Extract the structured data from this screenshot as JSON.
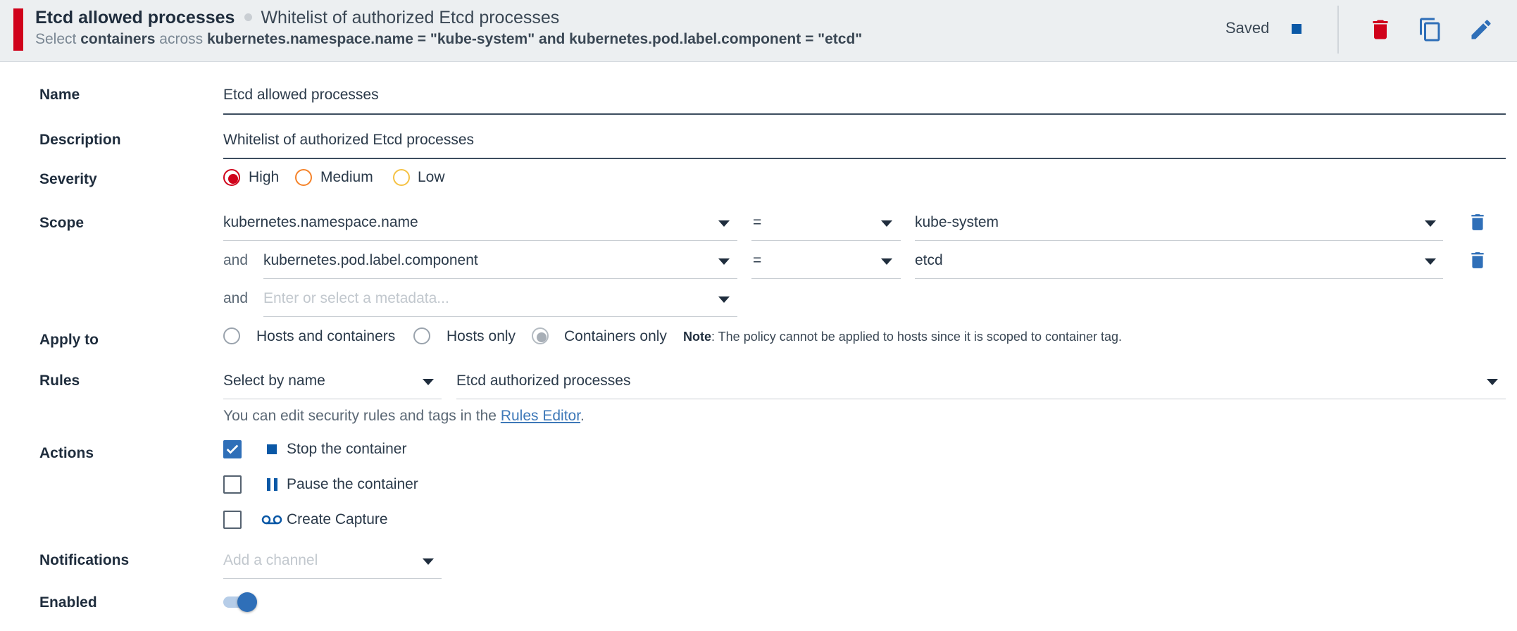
{
  "header": {
    "policy_name": "Etcd allowed processes",
    "policy_description": "Whitelist of authorized Etcd processes",
    "scope_select": "Select",
    "scope_entity": "containers",
    "scope_across": "across",
    "scope_expression": "kubernetes.namespace.name = \"kube-system\" and kubernetes.pod.label.component = \"etcd\"",
    "status": "Saved",
    "severity_color": "#d0021b"
  },
  "form": {
    "name": {
      "label": "Name",
      "value": "Etcd allowed processes"
    },
    "description": {
      "label": "Description",
      "value": "Whitelist of authorized Etcd processes"
    },
    "severity": {
      "label": "Severity",
      "options": [
        {
          "label": "High",
          "color": "#d0021b",
          "selected": true
        },
        {
          "label": "Medium",
          "color": "#f5832a",
          "selected": false
        },
        {
          "label": "Low",
          "color": "#f5c244",
          "selected": false
        }
      ]
    },
    "scope": {
      "label": "Scope",
      "conjunction": "and",
      "rows": [
        {
          "key": "kubernetes.namespace.name",
          "operator": "=",
          "value": "kube-system"
        },
        {
          "key": "kubernetes.pod.label.component",
          "operator": "=",
          "value": "etcd"
        }
      ],
      "new_placeholder": "Enter or select a metadata..."
    },
    "apply_to": {
      "label": "Apply to",
      "options": [
        {
          "label": "Hosts and containers",
          "selected": false
        },
        {
          "label": "Hosts only",
          "selected": false
        },
        {
          "label": "Containers only",
          "selected": true
        }
      ],
      "note_label": "Note",
      "note_text": ": The policy cannot be applied to hosts since it is scoped to container tag."
    },
    "rules": {
      "label": "Rules",
      "mode": "Select by name",
      "value": "Etcd authorized processes",
      "help_prefix": "You can edit security rules and tags in the ",
      "help_link": "Rules Editor",
      "help_suffix": "."
    },
    "actions": {
      "label": "Actions",
      "items": [
        {
          "label": "Stop the container",
          "checked": true,
          "icon": "stop-icon"
        },
        {
          "label": "Pause the container",
          "checked": false,
          "icon": "pause-icon"
        },
        {
          "label": "Create Capture",
          "checked": false,
          "icon": "capture-icon"
        }
      ]
    },
    "notifications": {
      "label": "Notifications",
      "placeholder": "Add a channel"
    },
    "enabled": {
      "label": "Enabled",
      "value": true
    }
  },
  "colors": {
    "accent": "#2f6fb8",
    "danger": "#d0021b",
    "icon_blue": "#2f6fb8"
  }
}
